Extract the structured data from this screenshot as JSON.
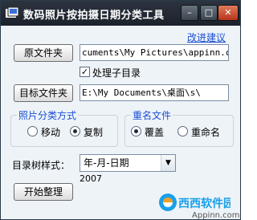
{
  "window": {
    "title": "数码照片按拍摄日期分类工具",
    "minimize_glyph": "–",
    "maximize_glyph": "□",
    "close_glyph": "✕"
  },
  "feedback_link": "改进建议",
  "source": {
    "button_label": "原文件夹",
    "path": "cuments\\My Pictures\\appinn.com"
  },
  "subdirs": {
    "label": "处理子目录",
    "checked": true
  },
  "target": {
    "button_label": "目标文件夹",
    "path": "E:\\My Documents\\桌面\\s\\"
  },
  "photo_mode": {
    "title": "照片分类方式",
    "options": [
      {
        "label": "移动",
        "selected": false
      },
      {
        "label": "复制",
        "selected": true
      }
    ]
  },
  "duplicate": {
    "title": "重名文件",
    "options": [
      {
        "label": "覆盖",
        "selected": true
      },
      {
        "label": "重命名",
        "selected": false
      }
    ]
  },
  "tree_style": {
    "label": "目录树样式：",
    "selected": "年-月-日期",
    "example": "2007"
  },
  "start_button": "开始整理",
  "watermark": {
    "logo_text": "西西软件园",
    "url_text": "Appinn.com",
    "brand_color": "#1aa0e8",
    "accent_color": "#f0a020"
  },
  "colors": {
    "title_bar": "#1c222b",
    "link": "#1a4fd6",
    "client_bg": "#eef3f8"
  }
}
